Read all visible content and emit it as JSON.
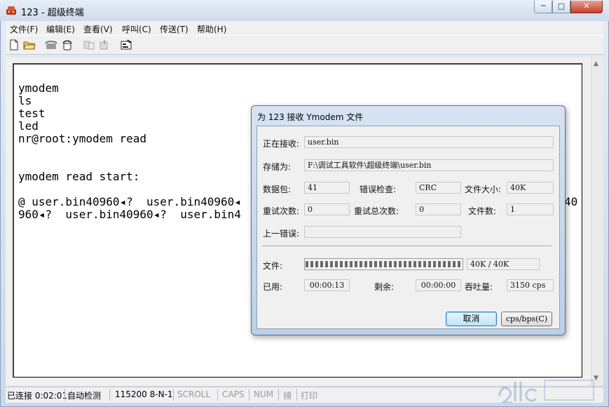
{
  "window": {
    "title": "123 - 超级终端",
    "controls": {
      "minimize": "─",
      "maximize": "□",
      "close": "✕"
    }
  },
  "menu": [
    "文件(F)",
    "编辑(E)",
    "查看(V)",
    "呼叫(C)",
    "传送(T)",
    "帮助(H)"
  ],
  "toolbar": [
    "new-file-icon",
    "open-folder-icon",
    "phone-icon",
    "disconnect-icon",
    "send-icon",
    "receive-icon",
    "properties-icon"
  ],
  "terminal": {
    "lines": [
      "ymodem",
      "ls",
      "test",
      "led",
      "nr@root:ymodem read",
      "",
      "",
      "ymodem read start:",
      "",
      "@ user.bin40960◂?  user.bin40960◂",
      "960◂?  user.bin40960◂?  user.bin4"
    ],
    "overflow_fragment": "40"
  },
  "status": {
    "connected": "已连接 0:02:01",
    "detect": "自动检测",
    "port": "115200 8-N-1",
    "scroll": "SCROLL",
    "caps": "CAPS",
    "num": "NUM",
    "capture": "捕",
    "print": "打印"
  },
  "dialog": {
    "title": "为 123 接收 Ymodem 文件",
    "receiving_label": "正在接收:",
    "receiving_value": "user.bin",
    "save_label": "存储为:",
    "save_value": "F:\\调试工具软件\\超级终端\\user.bin",
    "packet_label": "数据包:",
    "packet_value": "41",
    "errcheck_label": "错误检查:",
    "errcheck_value": "CRC",
    "filesize_label": "文件大小:",
    "filesize_value": "40K",
    "retries_label": "重试次数:",
    "retries_value": "0",
    "total_retries_label": "重试总次数:",
    "total_retries_value": "0",
    "files_label": "文件数:",
    "files_value": "1",
    "last_error_label": "上一错误:",
    "last_error_value": "",
    "file_label": "文件:",
    "progress": 1.0,
    "progress_text": "40K / 40K",
    "elapsed_label": "已用:",
    "elapsed_value": "00:00:13",
    "remaining_label": "剩余:",
    "remaining_value": "00:00:00",
    "throughput_label": "吞吐量:",
    "throughput_value": "3150 cps",
    "cancel_button": "取消",
    "cps_button": "cps/bps(C)"
  }
}
